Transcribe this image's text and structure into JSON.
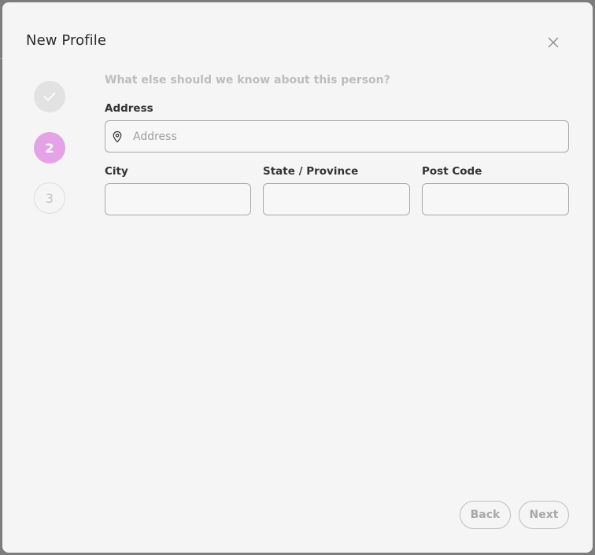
{
  "modal": {
    "title": "New Profile"
  },
  "steps": [
    {
      "state": "done",
      "label": ""
    },
    {
      "state": "active",
      "label": "2"
    },
    {
      "state": "pending",
      "label": "3"
    }
  ],
  "form": {
    "question": "What else should we know about this person?",
    "address": {
      "label": "Address",
      "placeholder": "Address",
      "value": ""
    },
    "city": {
      "label": "City",
      "value": ""
    },
    "state": {
      "label": "State / Province",
      "value": ""
    },
    "postcode": {
      "label": "Post Code",
      "value": ""
    }
  },
  "buttons": {
    "back": "Back",
    "next": "Next"
  },
  "colors": {
    "active_step": "#e4a3e6",
    "done_step": "#e2e2e2",
    "question_text": "#bdbdbd"
  },
  "icons": {
    "close": "close-icon",
    "done": "check-icon",
    "address": "map-pin-icon"
  }
}
